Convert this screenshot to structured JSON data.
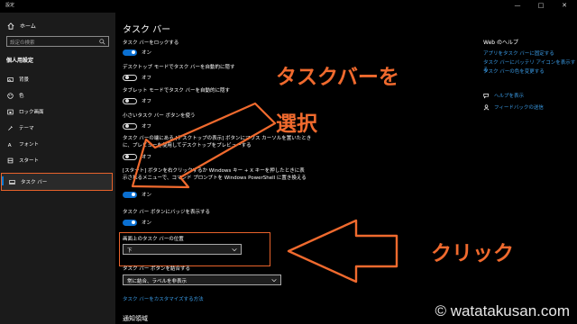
{
  "window": {
    "app_title": "設定",
    "minimize": "—",
    "maximize": "□",
    "close": "✕"
  },
  "sidebar": {
    "home": "ホーム",
    "search_placeholder": "設定の検索",
    "section": "個人用設定",
    "items": [
      {
        "label": "背景",
        "icon": "picture-icon"
      },
      {
        "label": "色",
        "icon": "palette-icon"
      },
      {
        "label": "ロック画面",
        "icon": "lock-screen-icon"
      },
      {
        "label": "テーマ",
        "icon": "theme-brush-icon"
      },
      {
        "label": "フォント",
        "icon": "font-icon"
      },
      {
        "label": "スタート",
        "icon": "start-icon"
      },
      {
        "label": "タスク バー",
        "icon": "taskbar-icon",
        "active": true
      }
    ]
  },
  "main": {
    "title": "タスク バー",
    "settings": [
      {
        "label": "タスク バーをロックする",
        "state": "オン"
      },
      {
        "label": "デスクトップ モードでタスク バーを自動的に隠す",
        "state": "オフ"
      },
      {
        "label": "タブレット モードでタスク バーを自動的に隠す",
        "state": "オフ"
      },
      {
        "label": "小さいタスク バー ボタンを使う",
        "state": "オフ"
      },
      {
        "label_line1": "タスク バーの端にある [デスクトップの表示] ボタンにマウス カーソルを置いたとき",
        "label_line2": "に、プレビューを使用してデスクトップをプレビューする",
        "state": "オフ"
      },
      {
        "label_line1": "[スタート] ボタンを右クリックするか Windows キー + X キーを押したときに表",
        "label_line2": "示されるメニューで、コマンド プロンプトを Windows PowerShell に置き換える",
        "state": "オン"
      },
      {
        "label": "タスク バー ボタンにバッジを表示する",
        "state": "オン"
      }
    ],
    "position": {
      "label": "画面上のタスク バーの位置",
      "value": "下"
    },
    "combine": {
      "label": "タスク バー ボタンを結合する",
      "value": "常に結合、ラベルを非表示"
    },
    "customize_link": "タスク バーをカスタマイズする方法",
    "notification_area": "通知領域"
  },
  "help": {
    "title": "Web のヘルプ",
    "links": [
      "アプリをタスク バーに固定する",
      "タスク バーにバッテリ アイコンを表示する",
      "タスク バーの色を変更する"
    ],
    "get_help": "ヘルプを表示",
    "feedback": "フィードバックの送信"
  },
  "annotations": {
    "select_taskbar_line1": "タスクバーを",
    "select_taskbar_line2": "選択",
    "click": "クリック",
    "accent_color": "#f06a2e"
  },
  "watermark": "© watatakusan.com"
}
